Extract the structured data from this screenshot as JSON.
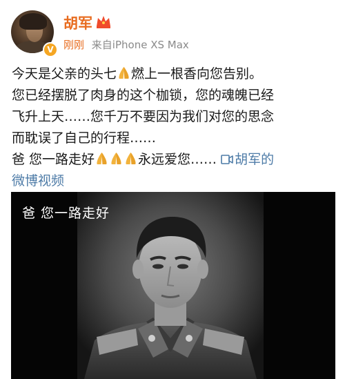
{
  "header": {
    "username": "胡军",
    "time": "刚刚",
    "source": "来自iPhone XS Max",
    "verified_icon": "verified-badge-icon",
    "member_icon": "crown-icon",
    "colors": {
      "username": "#e86c1f",
      "badge": "#f5a623",
      "link": "#4d7ba7"
    }
  },
  "post": {
    "line1_a": "今天是父亲的头七",
    "line1_b": "燃上一根香向您告别。",
    "line2": "您已经摆脱了肉身的这个枷锁，您的魂魄已经",
    "line3": "飞升上天……您千万不要因为我们对您的思念",
    "line4": "而耽误了自己的行程……",
    "line5_a": "爸  您一路走好",
    "line5_b": "永远爱您……",
    "video_link_a": "胡军的",
    "video_link_b": "微博视频",
    "pray_icon": "praying-hands-icon"
  },
  "video": {
    "caption": "爸  您一路走好",
    "portrait_icon": "portrait-image"
  }
}
